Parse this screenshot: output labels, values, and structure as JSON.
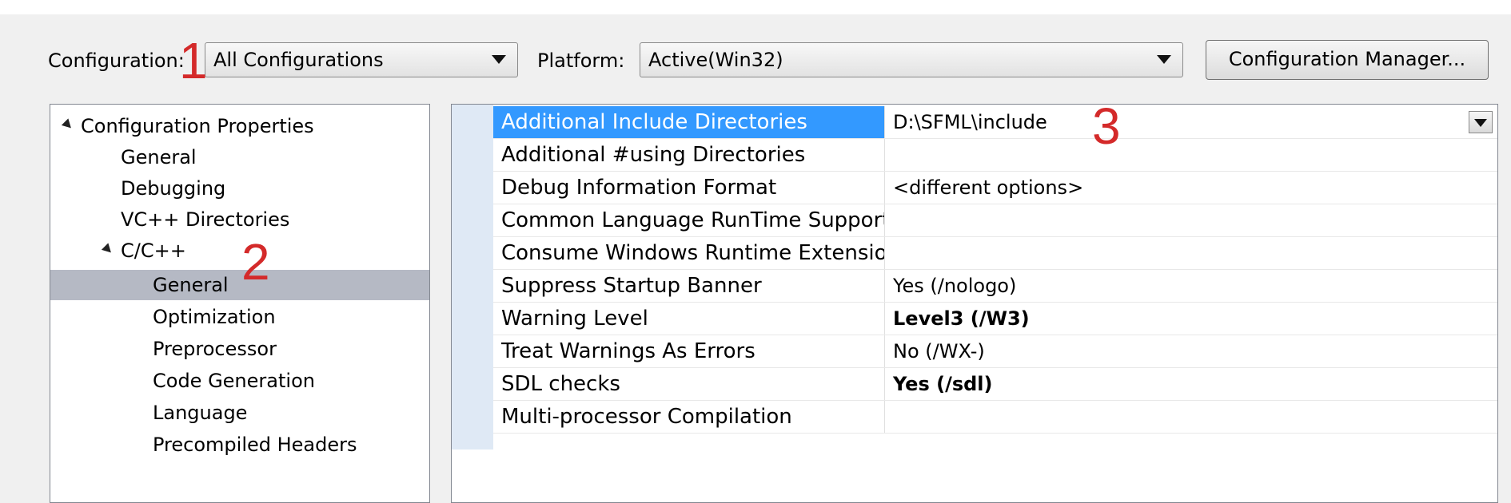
{
  "toolbar": {
    "configuration_label": "Configuration:",
    "configuration_value": "All Configurations",
    "platform_label": "Platform:",
    "platform_value": "Active(Win32)",
    "config_manager_label": "Configuration Manager..."
  },
  "annotations": [
    "1",
    "2",
    "3"
  ],
  "tree": {
    "items": [
      {
        "label": "Configuration Properties",
        "level": 0,
        "expanded": true
      },
      {
        "label": "General",
        "level": 1
      },
      {
        "label": "Debugging",
        "level": 1
      },
      {
        "label": "VC++ Directories",
        "level": 1
      },
      {
        "label": "C/C++",
        "level": 1,
        "expanded": true
      },
      {
        "label": "General",
        "level": 2,
        "selected": true
      },
      {
        "label": "Optimization",
        "level": 2
      },
      {
        "label": "Preprocessor",
        "level": 2
      },
      {
        "label": "Code Generation",
        "level": 2
      },
      {
        "label": "Language",
        "level": 2
      },
      {
        "label": "Precompiled Headers",
        "level": 2
      }
    ]
  },
  "properties": [
    {
      "name": "Additional Include Directories",
      "value": "D:\\SFML\\include",
      "selected": true
    },
    {
      "name": "Additional #using Directories",
      "value": ""
    },
    {
      "name": "Debug Information Format",
      "value": "<different options>"
    },
    {
      "name": "Common Language RunTime Support",
      "value": ""
    },
    {
      "name": "Consume Windows Runtime Extension",
      "value": ""
    },
    {
      "name": "Suppress Startup Banner",
      "value": "Yes (/nologo)"
    },
    {
      "name": "Warning Level",
      "value": "Level3 (/W3)",
      "bold": true
    },
    {
      "name": "Treat Warnings As Errors",
      "value": "No (/WX-)"
    },
    {
      "name": "SDL checks",
      "value": "Yes (/sdl)",
      "bold": true
    },
    {
      "name": "Multi-processor Compilation",
      "value": ""
    }
  ],
  "colors": {
    "selection": "#3399ff",
    "annotation": "#d42a2a",
    "tree_selection": "#b5b9c4"
  }
}
